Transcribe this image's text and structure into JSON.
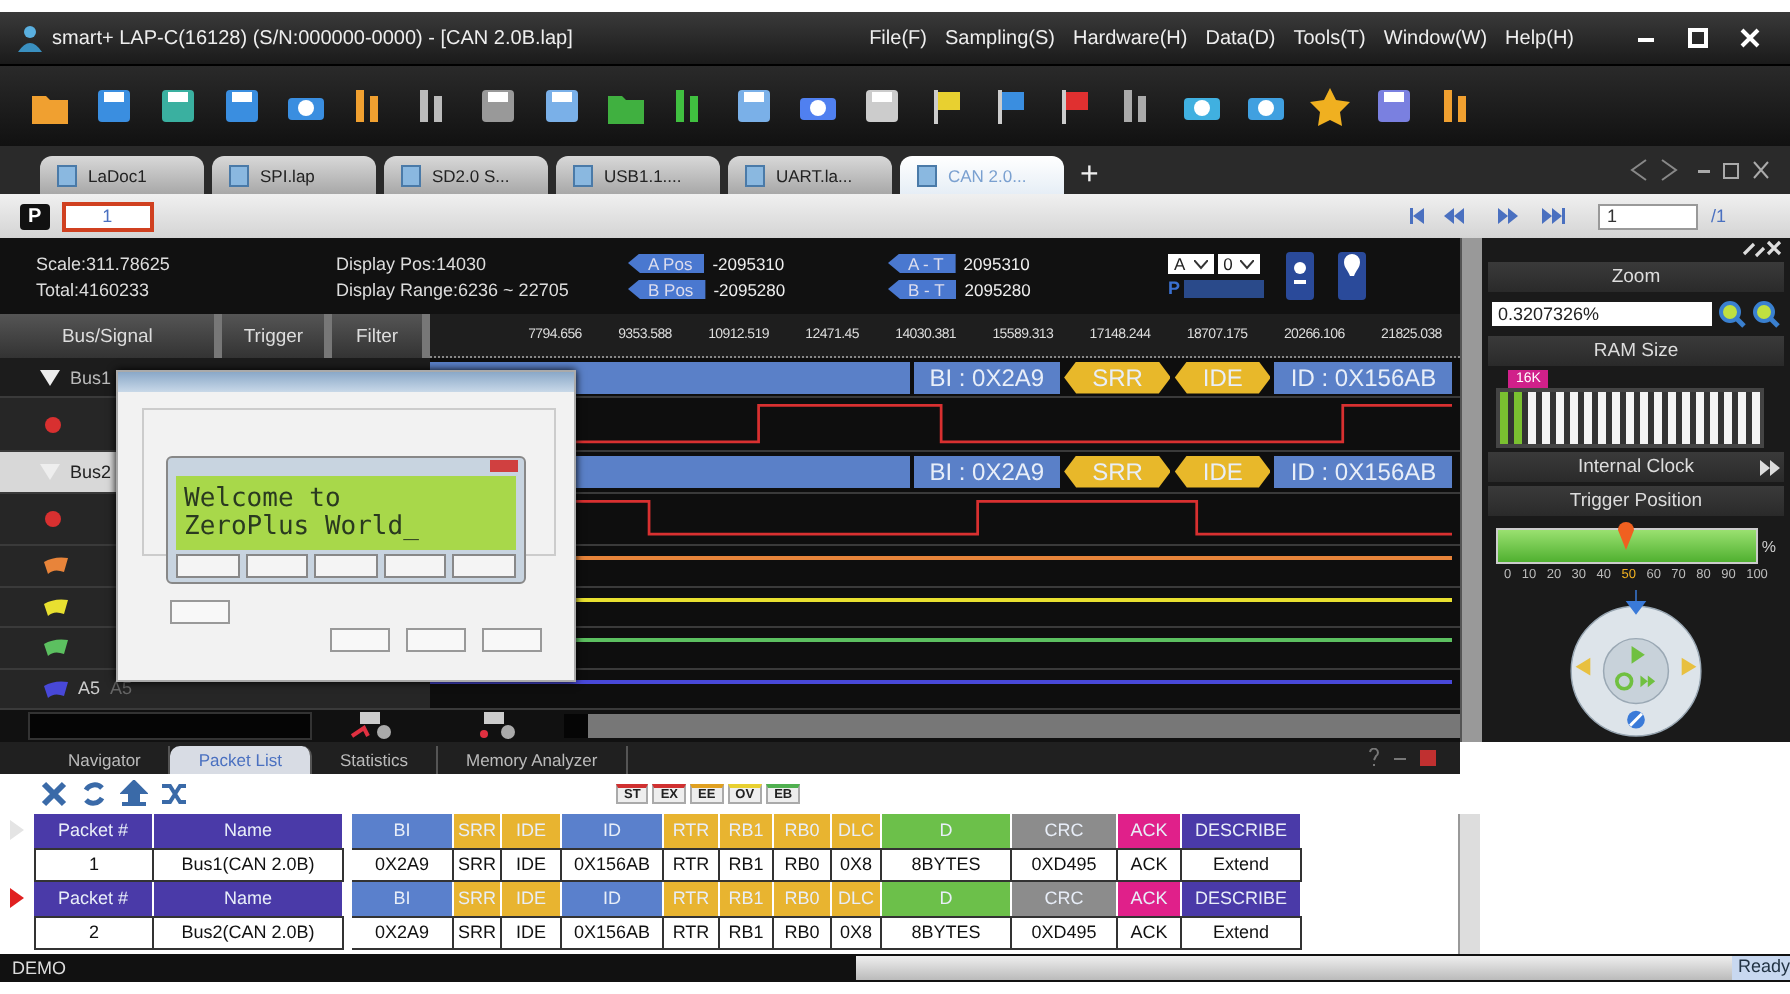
{
  "window": {
    "title": "smart+  LAP-C(16128) (S/N:000000-0000) - [CAN 2.0B.lap]"
  },
  "menu": [
    "File(F)",
    "Sampling(S)",
    "Hardware(H)",
    "Data(D)",
    "Tools(T)",
    "Window(W)",
    "Help(H)"
  ],
  "doc_tabs": [
    {
      "label": "LaDoc1",
      "selected": false
    },
    {
      "label": "SPI.lap",
      "selected": false
    },
    {
      "label": "SD2.0 S...",
      "selected": false
    },
    {
      "label": "USB1.1....",
      "selected": false
    },
    {
      "label": "UART.la...",
      "selected": false
    },
    {
      "label": "CAN 2.0...",
      "selected": true
    }
  ],
  "new_tab": "+",
  "page_bar": {
    "badge": "P",
    "page": "1",
    "page_field": "1",
    "total": "/1"
  },
  "info": {
    "scale": "Scale:311.78625",
    "total": "Total:4160233",
    "display_pos": "Display Pos:14030",
    "display_range": "Display Range:6236 ~ 22705",
    "cursors": [
      {
        "label": "A Pos",
        "value": "-2095310"
      },
      {
        "label": "B Pos",
        "value": "-2095280"
      },
      {
        "label": "A - T",
        "value": "2095310"
      },
      {
        "label": "B - T",
        "value": "2095280"
      }
    ],
    "selects": [
      "A",
      "0"
    ],
    "p_label": "P"
  },
  "signal_tabs": [
    "Bus/Signal",
    "Trigger",
    "Filter"
  ],
  "time_ticks": [
    "7794.656",
    "9353.588",
    "10912.519",
    "12471.45",
    "14030.381",
    "15589.313",
    "17148.244",
    "18707.175",
    "20266.106",
    "21825.038"
  ],
  "signals": [
    {
      "kind": "bus",
      "label": "Bus1",
      "expanded": true,
      "selected": false,
      "segments": [
        {
          "kind": "field",
          "text": "BI : 0X2A9"
        },
        {
          "kind": "flag",
          "text": "SRR"
        },
        {
          "kind": "flag",
          "text": "IDE"
        },
        {
          "kind": "field",
          "text": "ID : 0X156AB"
        }
      ]
    },
    {
      "kind": "dot",
      "color": "#d83030"
    },
    {
      "kind": "bus",
      "label": "Bus2",
      "expanded": true,
      "selected": true,
      "segments": [
        {
          "kind": "field",
          "text": "BI : 0X2A9"
        },
        {
          "kind": "flag",
          "text": "SRR"
        },
        {
          "kind": "flag",
          "text": "IDE"
        },
        {
          "kind": "field",
          "text": "ID : 0X156AB"
        }
      ]
    },
    {
      "kind": "dot",
      "color": "#d83030"
    },
    {
      "kind": "flag",
      "color": "#e8843a"
    },
    {
      "kind": "flag",
      "color": "#e8e030"
    },
    {
      "kind": "flag",
      "color": "#5cc060"
    },
    {
      "kind": "flag",
      "color": "#4848d8",
      "label": "A5",
      "label_2": "A5"
    }
  ],
  "dialog": {
    "lcd_lines": [
      "Welcome to",
      "ZeroPlus World_"
    ]
  },
  "right_panel": {
    "zoom_title": "Zoom",
    "zoom_value": "0.3207326%",
    "ram_title": "RAM Size",
    "ram_badge": "16K",
    "ram_meter": {
      "level": 0.1
    },
    "clock_title": "Internal Clock",
    "trigger_title": "Trigger Position",
    "trigger_slider": {
      "level": 0.5
    },
    "trigger_unit": "%",
    "trigger_ticks": [
      {
        "label": "0",
        "selected": false
      },
      {
        "label": "10",
        "selected": false
      },
      {
        "label": "20",
        "selected": false
      },
      {
        "label": "30",
        "selected": false
      },
      {
        "label": "40",
        "selected": false
      },
      {
        "label": "50",
        "selected": true
      },
      {
        "label": "60",
        "selected": false
      },
      {
        "label": "70",
        "selected": false
      },
      {
        "label": "80",
        "selected": false
      },
      {
        "label": "90",
        "selected": false
      },
      {
        "label": "100",
        "selected": false
      }
    ]
  },
  "bottom_tabs": [
    {
      "label": "Navigator",
      "selected": false
    },
    {
      "label": "Packet List",
      "selected": true
    },
    {
      "label": "Statistics",
      "selected": false
    },
    {
      "label": "Memory Analyzer",
      "selected": false
    }
  ],
  "legend": [
    {
      "label": "ST",
      "color": "#d03030"
    },
    {
      "label": "EX",
      "color": "#d03030"
    },
    {
      "label": "EE",
      "color": "#e0a020"
    },
    {
      "label": "OV",
      "color": "#e8d030"
    },
    {
      "label": "EB",
      "color": "#50b050"
    }
  ],
  "packets": [
    {
      "selected": false,
      "header": [
        {
          "label": "Packet #",
          "color": "#4a3aa8"
        },
        {
          "label": "Name",
          "color": "#4a3aa8"
        },
        {
          "label": "BI",
          "color": "#5a80cc"
        },
        {
          "label": "SRR",
          "color": "#e8b430"
        },
        {
          "label": "IDE",
          "color": "#e8b430"
        },
        {
          "label": "ID",
          "color": "#5a80cc"
        },
        {
          "label": "RTR",
          "color": "#e8b430"
        },
        {
          "label": "RB1",
          "color": "#e8b430"
        },
        {
          "label": "RB0",
          "color": "#e8b430"
        },
        {
          "label": "DLC",
          "color": "#e8b430"
        },
        {
          "label": "D",
          "color": "#6cc04a"
        },
        {
          "label": "CRC",
          "color": "#8c8c8c"
        },
        {
          "label": "ACK",
          "color": "#e0208a"
        },
        {
          "label": "DESCRIBE",
          "color": "#4a3aa8"
        }
      ],
      "cells": [
        "1",
        "Bus1(CAN 2.0B)",
        "0X2A9",
        "SRR",
        "IDE",
        "0X156AB",
        "RTR",
        "RB1",
        "RB0",
        "0X8",
        "8BYTES",
        "0XD495",
        "ACK",
        "Extend"
      ]
    },
    {
      "selected": true,
      "header": [
        {
          "label": "Packet #",
          "color": "#4a3aa8"
        },
        {
          "label": "Name",
          "color": "#4a3aa8"
        },
        {
          "label": "BI",
          "color": "#5a80cc"
        },
        {
          "label": "SRR",
          "color": "#e8b430"
        },
        {
          "label": "IDE",
          "color": "#e8b430"
        },
        {
          "label": "ID",
          "color": "#5a80cc"
        },
        {
          "label": "RTR",
          "color": "#e8b430"
        },
        {
          "label": "RB1",
          "color": "#e8b430"
        },
        {
          "label": "RB0",
          "color": "#e8b430"
        },
        {
          "label": "DLC",
          "color": "#e8b430"
        },
        {
          "label": "D",
          "color": "#6cc04a"
        },
        {
          "label": "CRC",
          "color": "#8c8c8c"
        },
        {
          "label": "ACK",
          "color": "#e0208a"
        },
        {
          "label": "DESCRIBE",
          "color": "#4a3aa8"
        }
      ],
      "cells": [
        "2",
        "Bus2(CAN 2.0B)",
        "0X2A9",
        "SRR",
        "IDE",
        "0X156AB",
        "RTR",
        "RB1",
        "RB0",
        "0X8",
        "8BYTES",
        "0XD495",
        "ACK",
        "Extend"
      ]
    }
  ],
  "status": {
    "left": "DEMO",
    "right": "Ready"
  }
}
